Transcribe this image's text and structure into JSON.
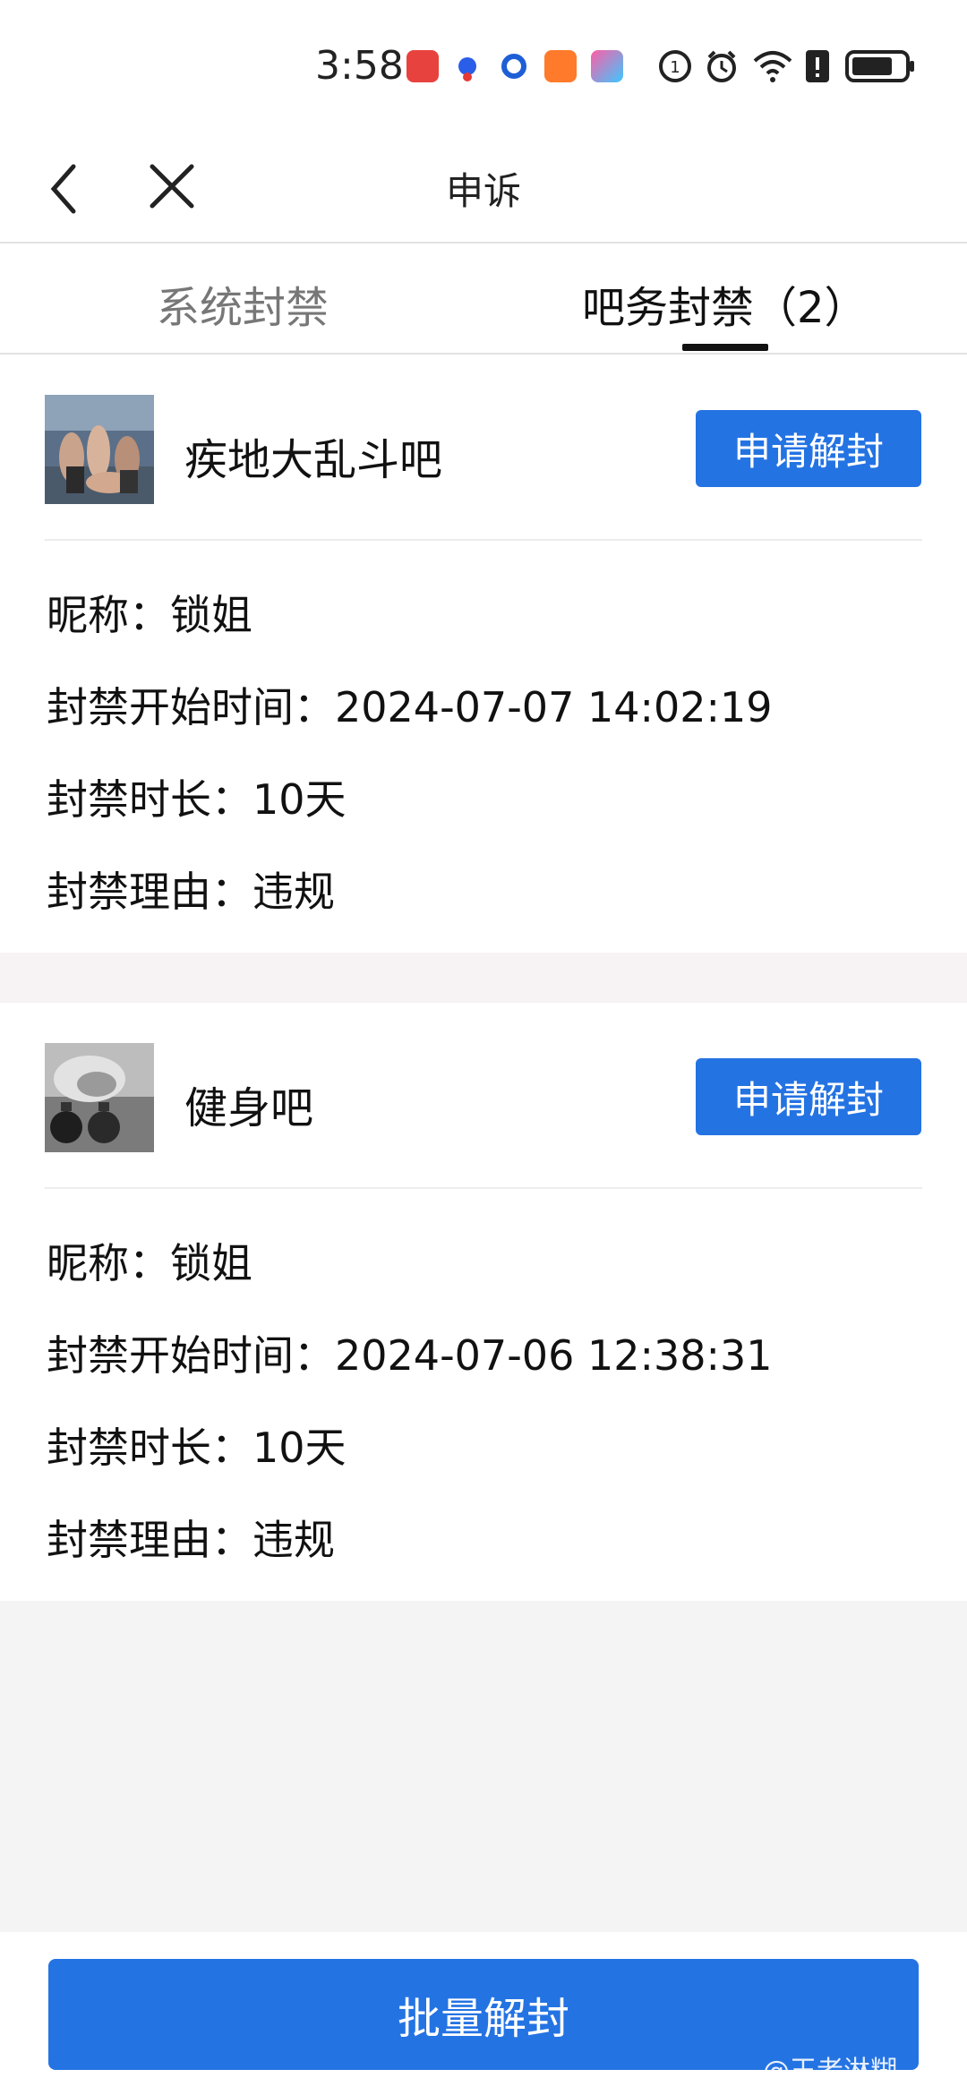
{
  "status": {
    "time": "3:58"
  },
  "header": {
    "title": "申诉"
  },
  "tabs": [
    {
      "label": "系统封禁",
      "active": false
    },
    {
      "label": "吧务封禁（2）",
      "active": true
    }
  ],
  "bans": [
    {
      "bar_name": "疾地大乱斗吧",
      "button": "申请解封",
      "nickname": "昵称：锁姐",
      "start": "封禁开始时间：2024-07-07 14:02:19",
      "duration": "封禁时长：10天",
      "reason": "封禁理由：违规"
    },
    {
      "bar_name": "健身吧",
      "button": "申请解封",
      "nickname": "昵称：锁姐",
      "start": "封禁开始时间：2024-07-06 12:38:31",
      "duration": "封禁时长：10天",
      "reason": "封禁理由：违规"
    }
  ],
  "footer": {
    "batch_button": "批量解封",
    "watermark": "@王者淋糊"
  },
  "colors": {
    "primary": "#2473e3",
    "tab_inactive": "#777777"
  },
  "icons": [
    "back-icon",
    "close-icon",
    "wifi-icon",
    "battery-icon",
    "alarm-icon",
    "signal-icon"
  ]
}
